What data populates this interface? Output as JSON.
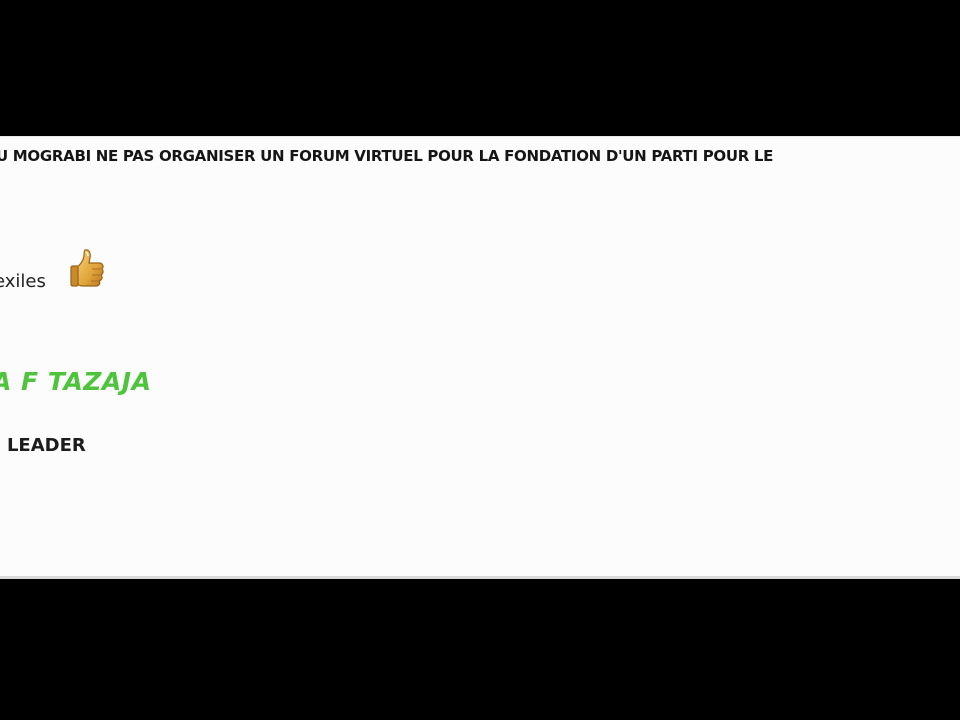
{
  "post": {
    "headline": "U MOGRABI NE PAS ORGANISER UN FORUM VIRTUEL POUR LA FONDATION D'UN PARTI POUR LE",
    "exiles_text": "exiles",
    "tazaja_text": "A F TAZAJA",
    "leader_text": "I LEADER",
    "emoticon": "thumbs-up-icon"
  },
  "colors": {
    "letterbox": "#000000",
    "panel": "#fcfcfc",
    "green_text": "#4ec43c",
    "thumb": "#e0a43a"
  }
}
